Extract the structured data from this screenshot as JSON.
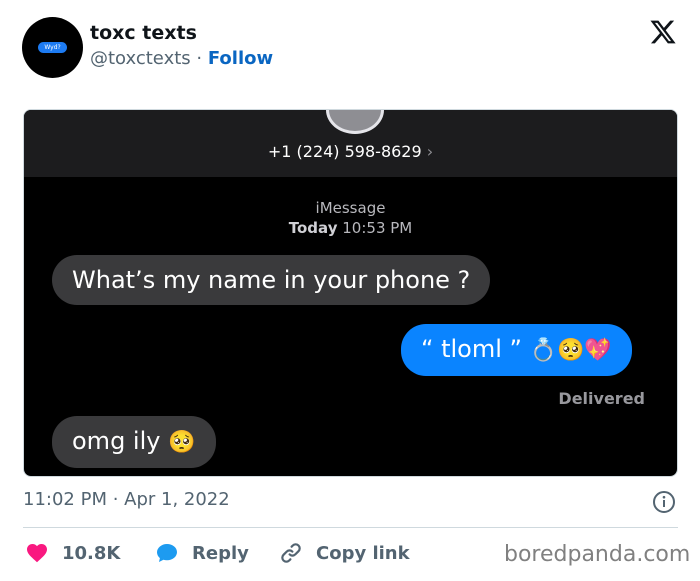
{
  "author": {
    "display_name": "toxc texts",
    "handle": "@toxctexts",
    "separator": "·",
    "follow_label": "Follow",
    "avatar_text": "Wyd?"
  },
  "screenshot": {
    "contact_number": "+1 (224) 598-8629",
    "chevron": "›",
    "service_label": "iMessage",
    "day_label": "Today",
    "time_label": "10:53 PM",
    "messages": [
      {
        "direction": "incoming",
        "text": "What’s my name in your phone ?",
        "emoji": ""
      },
      {
        "direction": "outgoing",
        "text": "“ tloml ”",
        "emoji": "💍🥺💖"
      },
      {
        "direction": "incoming",
        "text": "omg ily",
        "emoji": "🥺"
      }
    ],
    "status_label": "Delivered"
  },
  "timestamp": "11:02 PM · Apr 1, 2022",
  "actions": {
    "like_count": "10.8K",
    "reply_label": "Reply",
    "copy_link_label": "Copy link"
  },
  "watermark": "boredpanda.com",
  "colors": {
    "like_red": "#f91880",
    "reply_blue": "#1d9bf0",
    "follow_blue": "#0a66c2",
    "imessage_blue": "#0a84ff",
    "incoming_gray": "#3a3a3c"
  },
  "icons": [
    "x-logo-icon",
    "info-icon",
    "heart-icon",
    "reply-bubble-icon",
    "link-icon"
  ]
}
